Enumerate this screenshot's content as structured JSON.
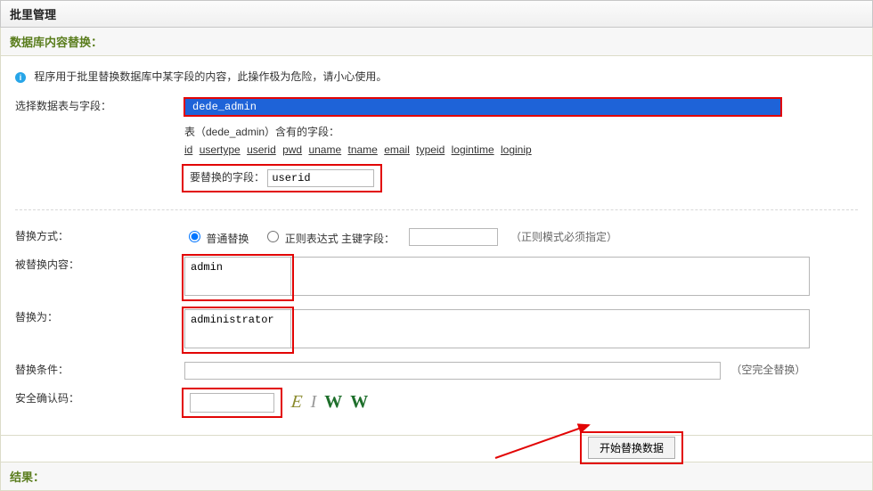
{
  "header": {
    "title": "批里管理"
  },
  "section": {
    "title": "数据库内容替换："
  },
  "warning": {
    "text": "程序用于批里替换数据库中某字段的内容，此操作极为危险，请小心使用。"
  },
  "labels": {
    "select_table": "选择数据表与字段：",
    "replace_mode": "替换方式：",
    "src_content": "被替换内容：",
    "dst_content": "替换为：",
    "condition": "替换条件：",
    "captcha": "安全确认码："
  },
  "table_select": {
    "selected": "dede_admin",
    "fields_prefix": "表（dede_admin）含有的字段：",
    "fields": [
      "id",
      "usertype",
      "userid",
      "pwd",
      "uname",
      "tname",
      "email",
      "typeid",
      "logintime",
      "loginip"
    ],
    "field_to_replace_label": "要替换的字段：",
    "field_to_replace": "userid"
  },
  "mode": {
    "normal": "普通替换",
    "regex": "正则表达式 主键字段：",
    "pk_value": "",
    "regex_hint": "（正则模式必须指定）"
  },
  "values": {
    "src": "admin",
    "dst": "administrator",
    "condition": "",
    "condition_hint": "（空完全替换）",
    "captcha_input": "",
    "captcha_display": [
      "E",
      "I",
      "W",
      "W"
    ]
  },
  "submit": {
    "label": "开始替换数据"
  },
  "result": {
    "title": "结果："
  }
}
